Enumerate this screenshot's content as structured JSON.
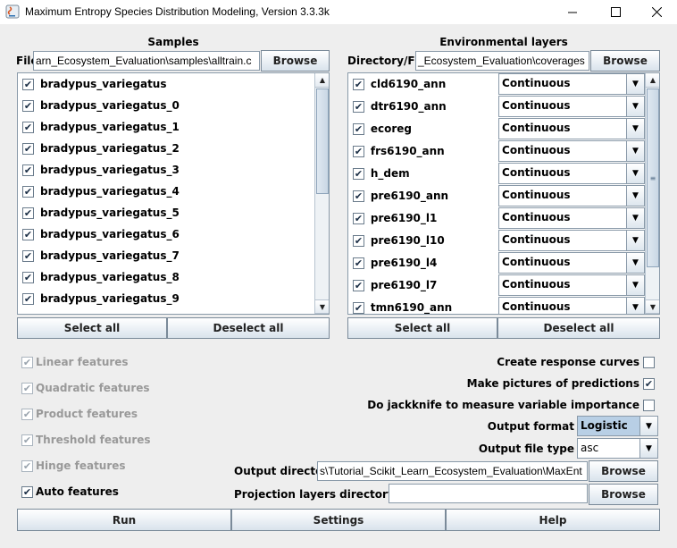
{
  "window": {
    "title": "Maximum Entropy Species Distribution Modeling, Version 3.3.3k"
  },
  "samples": {
    "header": "Samples",
    "file_label": "File",
    "file_value": "arn_Ecosystem_Evaluation\\samples\\alltrain.c",
    "browse": "Browse",
    "items": [
      {
        "name": "bradypus_variegatus"
      },
      {
        "name": "bradypus_variegatus_0"
      },
      {
        "name": "bradypus_variegatus_1"
      },
      {
        "name": "bradypus_variegatus_2"
      },
      {
        "name": "bradypus_variegatus_3"
      },
      {
        "name": "bradypus_variegatus_4"
      },
      {
        "name": "bradypus_variegatus_5"
      },
      {
        "name": "bradypus_variegatus_6"
      },
      {
        "name": "bradypus_variegatus_7"
      },
      {
        "name": "bradypus_variegatus_8"
      },
      {
        "name": "bradypus_variegatus_9"
      }
    ],
    "select_all": "Select all",
    "deselect_all": "Deselect all"
  },
  "environment": {
    "header": "Environmental layers",
    "dir_label": "Directory/File",
    "dir_value": "_Ecosystem_Evaluation\\coverages",
    "browse": "Browse",
    "layers": [
      {
        "name": "cld6190_ann",
        "type": "Continuous"
      },
      {
        "name": "dtr6190_ann",
        "type": "Continuous"
      },
      {
        "name": "ecoreg",
        "type": "Continuous"
      },
      {
        "name": "frs6190_ann",
        "type": "Continuous"
      },
      {
        "name": "h_dem",
        "type": "Continuous"
      },
      {
        "name": "pre6190_ann",
        "type": "Continuous"
      },
      {
        "name": "pre6190_l1",
        "type": "Continuous"
      },
      {
        "name": "pre6190_l10",
        "type": "Continuous"
      },
      {
        "name": "pre6190_l4",
        "type": "Continuous"
      },
      {
        "name": "pre6190_l7",
        "type": "Continuous"
      },
      {
        "name": "tmn6190_ann",
        "type": "Continuous"
      }
    ],
    "select_all": "Select all",
    "deselect_all": "Deselect all"
  },
  "features": [
    {
      "label": "Linear features",
      "checked": true,
      "enabled": false
    },
    {
      "label": "Quadratic features",
      "checked": true,
      "enabled": false
    },
    {
      "label": "Product features",
      "checked": true,
      "enabled": false
    },
    {
      "label": "Threshold features",
      "checked": true,
      "enabled": false
    },
    {
      "label": "Hinge features",
      "checked": true,
      "enabled": false
    },
    {
      "label": "Auto features",
      "checked": true,
      "enabled": true
    }
  ],
  "options": {
    "response_curves": {
      "label": "Create response curves",
      "checked": false
    },
    "pictures": {
      "label": "Make pictures of predictions",
      "checked": true
    },
    "jackknife": {
      "label": "Do jackknife to measure variable importance",
      "checked": false
    },
    "output_format_label": "Output format",
    "output_format_value": "Logistic",
    "output_file_type_label": "Output file type",
    "output_file_type_value": "asc",
    "output_dir_label": "Output directory",
    "output_dir_value": "s\\Tutorial_Scikit_Learn_Ecosystem_Evaluation\\MaxEnt",
    "projection_label": "Projection layers directory/file",
    "projection_value": "",
    "browse": "Browse"
  },
  "bottom": {
    "run": "Run",
    "settings": "Settings",
    "help": "Help"
  },
  "colors": {
    "highlight_combo": "#b8cfe5",
    "window_bg": "#eeeeee"
  }
}
